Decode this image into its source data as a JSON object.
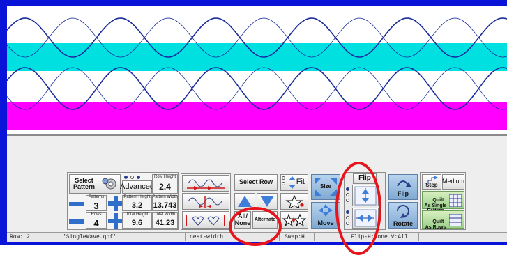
{
  "colors": {
    "frame": "#0a14d8",
    "band_cyan": "#00e0e0",
    "band_magenta": "#ff00ff",
    "wave": "#1a2a9a",
    "highlight_ring": "#e8141c"
  },
  "pattern_panel": {
    "select_pattern_label": "Select\nPattern",
    "advanced_label": "Advanced",
    "patterns_label": "Patterns",
    "patterns_value": "3",
    "rows_label": "Rows",
    "rows_value": "4",
    "row_height_label": "Row Height",
    "row_height_value": "2.4",
    "pattern_height_label": "Pattern Height",
    "pattern_height_value": "3.2",
    "pattern_width_label": "Pattern Width",
    "pattern_width_value": "13.743",
    "total_height_label": "Total Height",
    "total_height_value": "9.6",
    "total_width_label": "Total Width",
    "total_width_value": "41.23"
  },
  "row_panel": {
    "select_row_label": "Select Row",
    "all_none_label": "All/\nNone",
    "alternate_label": "Alternate",
    "fit_label": "Fit"
  },
  "transform_panel": {
    "size_label": "Size",
    "move_label": "Move",
    "flip_header_label": "Flip",
    "flip_label": "Flip",
    "rotate_label": "Rotate"
  },
  "quilt_panel": {
    "step_label": "Step",
    "medium_label": "Medium",
    "quilt_single_label": "Quilt\nAs Single\nPattern",
    "quilt_rows_label": "Quilt\nAs Rows"
  },
  "status_bar": {
    "row": "Row: 2",
    "file": "'SingleWave.qpf'",
    "nest": "nest-width",
    "swap": "Swap:H",
    "flip": "Flip-H:None  V:All"
  }
}
